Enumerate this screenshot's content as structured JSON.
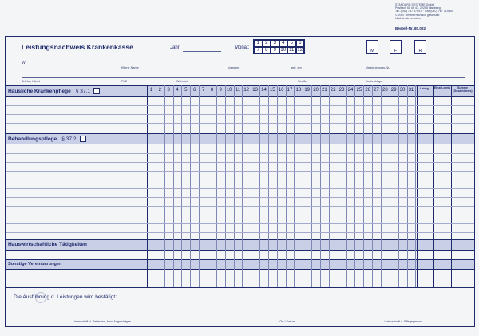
{
  "company": {
    "lines": [
      "STANDARD SYSTEME GmbH",
      "Postfach 60 06 41, 22206 Hamburg",
      "Tel. (040) 767 3749-0 · Fax (040) 767 319-60",
      "© 2007 Urheberrechtlich geschützt",
      "Nachdruck verboten"
    ],
    "order_number": "Bestell-Nr. 80.022"
  },
  "header": {
    "title": "Leistungsnachweis Krankenkasse",
    "year_label": "Jahr:",
    "month_label": "Monat:",
    "months": [
      "1",
      "2",
      "3",
      "4",
      "5",
      "6",
      "7",
      "8",
      "9",
      "10",
      "11",
      "12"
    ],
    "boxes": [
      "M",
      "F",
      "R"
    ]
  },
  "fields": {
    "w_label": "W:",
    "client_name": "Klient: Name",
    "first_name": "Vorname",
    "born": "geb. am",
    "insurance_no": "Versicherungs-Nr.",
    "phone": "Telefon Klient",
    "zip": "PLZ",
    "city": "Wohnort",
    "street": "Straße",
    "carrier": "Kostenträger"
  },
  "table": {
    "days": [
      "1",
      "2",
      "3",
      "4",
      "5",
      "6",
      "7",
      "8",
      "9",
      "10",
      "11",
      "12",
      "13",
      "14",
      "15",
      "16",
      "17",
      "18",
      "19",
      "20",
      "21",
      "22",
      "23",
      "24",
      "25",
      "26",
      "27",
      "28",
      "29",
      "30",
      "31"
    ],
    "col_leistg": "Leistg.",
    "col_einzel": "Einzel-preis",
    "col_summe": "Summe (Gesamtpreis)",
    "sections": {
      "home_care": "Häusliche Krankenpflege",
      "home_care_para": "§ 37.1",
      "treatment": "Behandlungspflege",
      "treatment_para": "§ 37.2",
      "housekeeping": "Hauswirtschaftliche Tätigkeiten",
      "other": "Sonstige Vereinbarungen"
    }
  },
  "footer": {
    "confirm_text": "Die Ausführung d. Leistungen wird bestätigt:",
    "sig_patient": "Unterschrift d. Patienten, bzw. Angehörigen",
    "sig_place_date": "Ort / Datum",
    "sig_service": "Unterschrift d. Pflegeperson"
  }
}
